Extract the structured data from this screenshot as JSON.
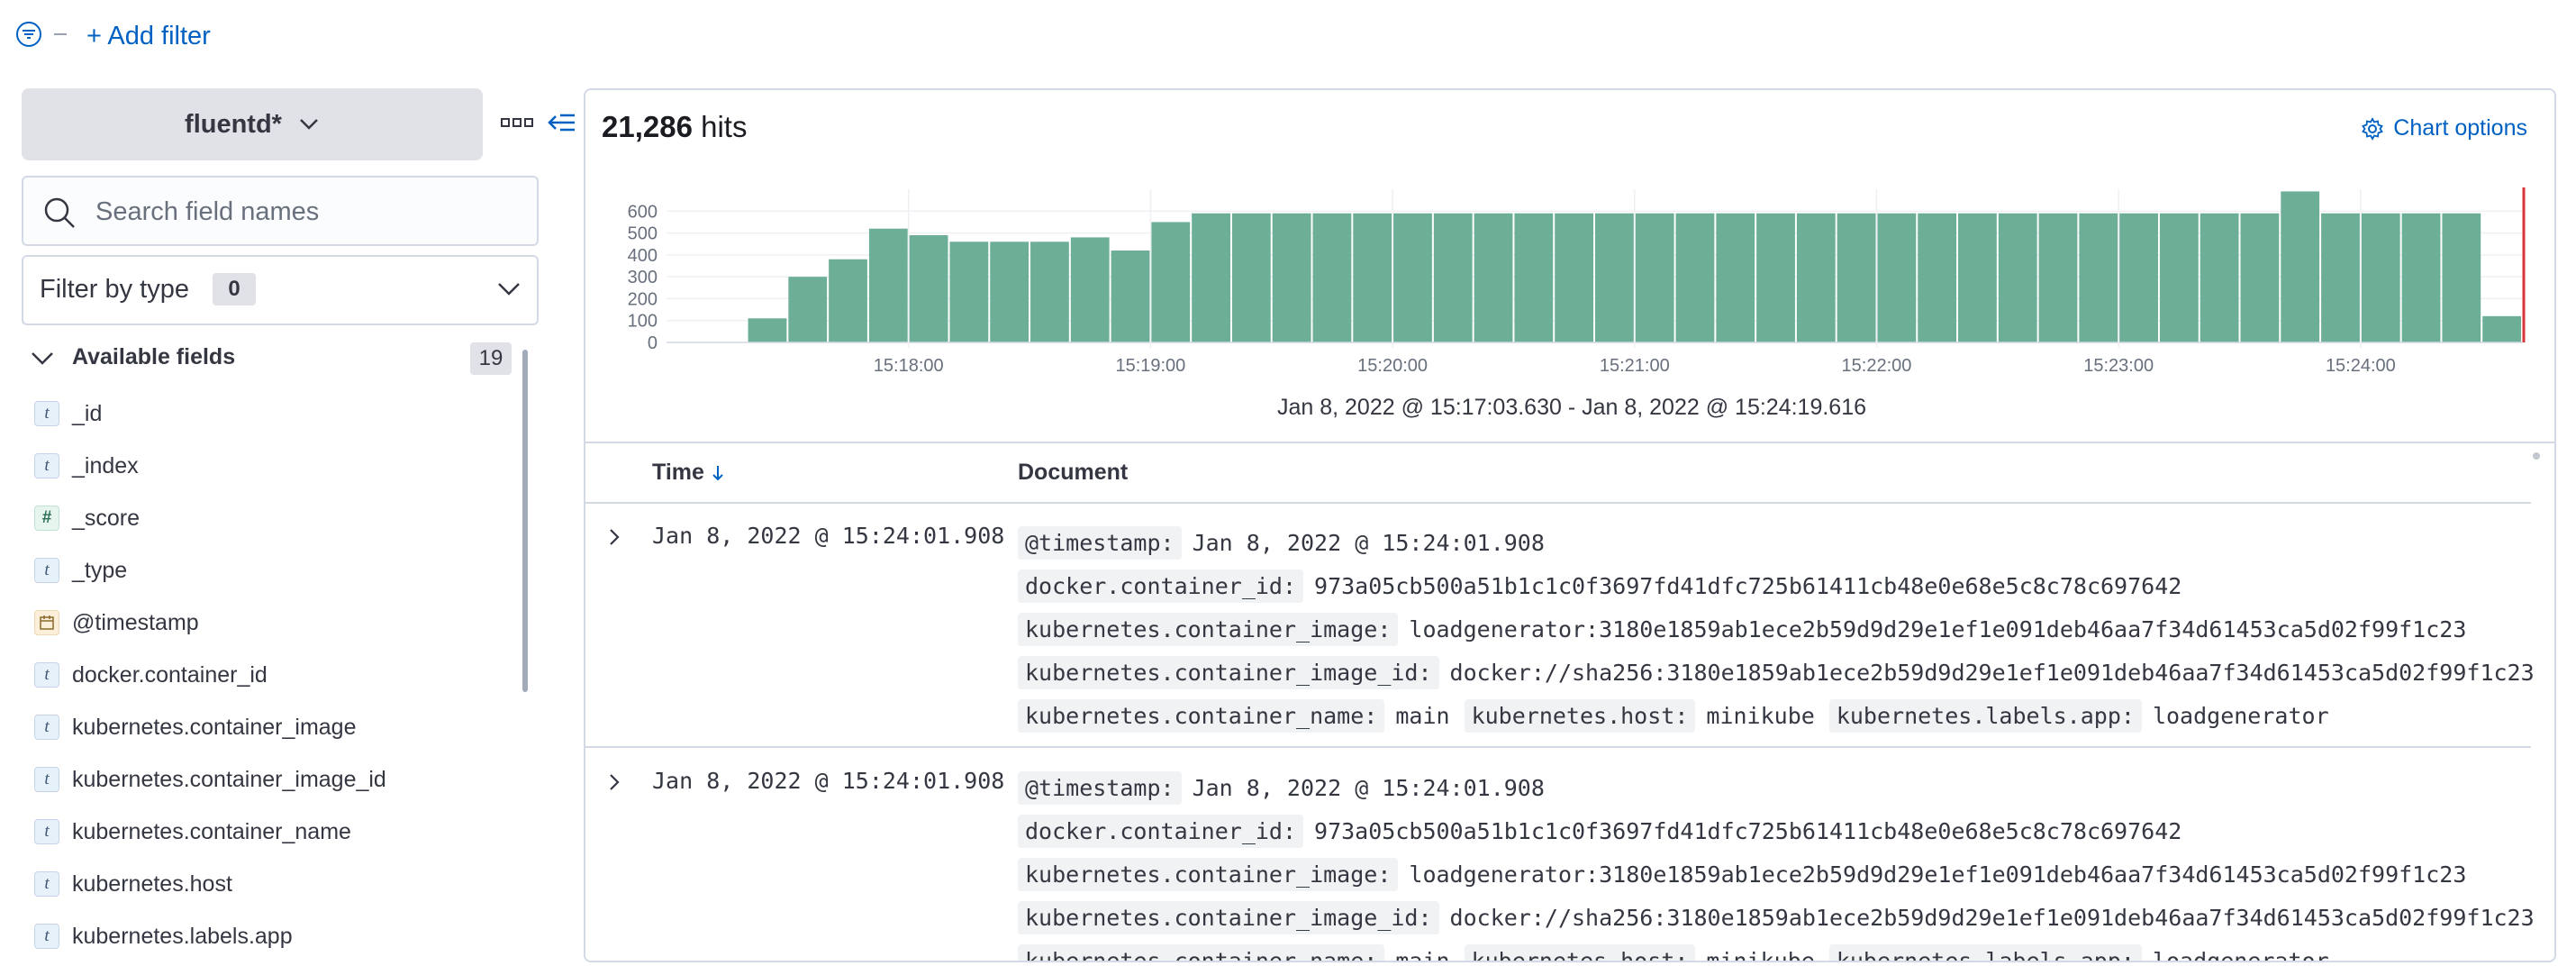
{
  "filter_bar": {
    "add_filter_label": "+ Add filter"
  },
  "sidebar": {
    "index_pattern": "fluentd*",
    "search": {
      "placeholder": "Search field names"
    },
    "filter_by_type": {
      "label": "Filter by type",
      "count": "0"
    },
    "available_fields": {
      "label": "Available fields",
      "count": "19"
    },
    "fields": [
      {
        "type": "t",
        "name": "_id"
      },
      {
        "type": "t",
        "name": "_index"
      },
      {
        "type": "#",
        "name": "_score"
      },
      {
        "type": "t",
        "name": "_type"
      },
      {
        "type": "date",
        "name": "@timestamp"
      },
      {
        "type": "t",
        "name": "docker.container_id"
      },
      {
        "type": "t",
        "name": "kubernetes.container_image"
      },
      {
        "type": "t",
        "name": "kubernetes.container_image_id"
      },
      {
        "type": "t",
        "name": "kubernetes.container_name"
      },
      {
        "type": "t",
        "name": "kubernetes.host"
      },
      {
        "type": "t",
        "name": "kubernetes.labels.app"
      }
    ]
  },
  "main": {
    "hits_count": "21,286",
    "hits_label": "hits",
    "chart_options_label": "Chart options",
    "time_range": "Jan 8, 2022 @ 15:17:03.630 - Jan 8, 2022 @ 15:24:19.616",
    "table": {
      "time_header": "Time",
      "document_header": "Document",
      "rows": [
        {
          "time": "Jan 8, 2022 @ 15:24:01.908",
          "lines": [
            [
              {
                "k": "@timestamp:",
                "v": "Jan 8, 2022 @ 15:24:01.908"
              }
            ],
            [
              {
                "k": "docker.container_id:",
                "v": "973a05cb500a51b1c1c0f3697fd41dfc725b61411cb48e0e68e5c8c78c697642"
              }
            ],
            [
              {
                "k": "kubernetes.container_image:",
                "v": "loadgenerator:3180e1859ab1ece2b59d9d29e1ef1e091deb46aa7f34d61453ca5d02f99f1c23"
              }
            ],
            [
              {
                "k": "kubernetes.container_image_id:",
                "v": "docker://sha256:3180e1859ab1ece2b59d9d29e1ef1e091deb46aa7f34d61453ca5d02f99f1c23"
              }
            ],
            [
              {
                "k": "kubernetes.container_name:",
                "v": "main"
              },
              {
                "k": "kubernetes.host:",
                "v": "minikube"
              },
              {
                "k": "kubernetes.labels.app:",
                "v": "loadgenerator"
              }
            ]
          ]
        },
        {
          "time": "Jan 8, 2022 @ 15:24:01.908",
          "lines": [
            [
              {
                "k": "@timestamp:",
                "v": "Jan 8, 2022 @ 15:24:01.908"
              }
            ],
            [
              {
                "k": "docker.container_id:",
                "v": "973a05cb500a51b1c1c0f3697fd41dfc725b61411cb48e0e68e5c8c78c697642"
              }
            ],
            [
              {
                "k": "kubernetes.container_image:",
                "v": "loadgenerator:3180e1859ab1ece2b59d9d29e1ef1e091deb46aa7f34d61453ca5d02f99f1c23"
              }
            ],
            [
              {
                "k": "kubernetes.container_image_id:",
                "v": "docker://sha256:3180e1859ab1ece2b59d9d29e1ef1e091deb46aa7f34d61453ca5d02f99f1c23"
              }
            ],
            [
              {
                "k": "kubernetes.container_name:",
                "v": "main"
              },
              {
                "k": "kubernetes.host:",
                "v": "minikube"
              },
              {
                "k": "kubernetes.labels.app:",
                "v": "loadgenerator"
              }
            ]
          ]
        }
      ]
    }
  },
  "colors": {
    "bar": "#6dae97",
    "link": "#0061c2",
    "now_marker": "#d8363a"
  },
  "chart_data": {
    "type": "bar",
    "title": "",
    "xlabel": "",
    "ylabel": "",
    "ylim": [
      0,
      700
    ],
    "y_ticks": [
      0,
      100,
      200,
      300,
      400,
      500,
      600
    ],
    "x_ticks": [
      "15:18:00",
      "15:19:00",
      "15:20:00",
      "15:21:00",
      "15:22:00",
      "15:23:00",
      "15:24:00"
    ],
    "x_start_label_offset_bins": 0,
    "bin_seconds": 10,
    "x_first_bin": "15:17:00",
    "values": [
      0,
      0,
      110,
      300,
      380,
      520,
      490,
      460,
      460,
      460,
      480,
      420,
      550,
      590,
      590,
      590,
      590,
      590,
      590,
      590,
      590,
      590,
      590,
      590,
      590,
      590,
      590,
      590,
      590,
      590,
      590,
      590,
      590,
      590,
      590,
      590,
      590,
      590,
      590,
      590,
      690,
      590,
      590,
      590,
      590,
      120
    ],
    "grid": true,
    "now_marker": true
  }
}
